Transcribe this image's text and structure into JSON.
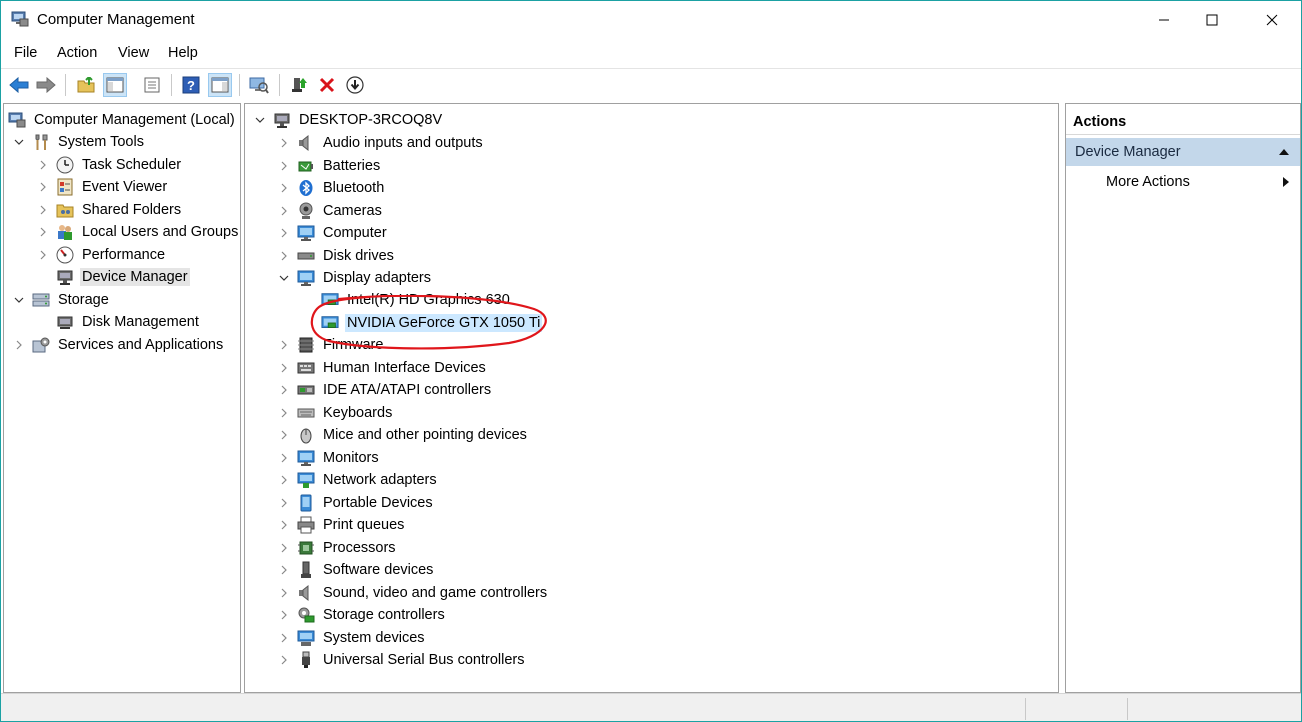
{
  "window": {
    "title": "Computer Management"
  },
  "menu": [
    "File",
    "Action",
    "View",
    "Help"
  ],
  "left_tree": {
    "root": "Computer Management (Local)",
    "system_tools": "System Tools",
    "task_scheduler": "Task Scheduler",
    "event_viewer": "Event Viewer",
    "shared_folders": "Shared Folders",
    "local_users": "Local Users and Groups",
    "performance": "Performance",
    "device_manager": "Device Manager",
    "storage": "Storage",
    "disk_management": "Disk Management",
    "services": "Services and Applications"
  },
  "device_tree": {
    "computer_name": "DESKTOP-3RCOQ8V",
    "categories_before": [
      {
        "label": "Audio inputs and outputs",
        "icon": "speaker-icon"
      },
      {
        "label": "Batteries",
        "icon": "battery-icon"
      },
      {
        "label": "Bluetooth",
        "icon": "bluetooth-icon"
      },
      {
        "label": "Cameras",
        "icon": "camera-icon"
      },
      {
        "label": "Computer",
        "icon": "monitor-icon"
      },
      {
        "label": "Disk drives",
        "icon": "disk-drive-icon"
      }
    ],
    "display_adapters": "Display adapters",
    "display_children": [
      "Intel(R) HD Graphics 630",
      "NVIDIA GeForce GTX 1050 Ti"
    ],
    "categories_after": [
      {
        "label": "Firmware",
        "icon": "firmware-icon"
      },
      {
        "label": "Human Interface Devices",
        "icon": "hid-icon"
      },
      {
        "label": "IDE ATA/ATAPI controllers",
        "icon": "ide-controller-icon"
      },
      {
        "label": "Keyboards",
        "icon": "keyboard-icon"
      },
      {
        "label": "Mice and other pointing devices",
        "icon": "mouse-icon"
      },
      {
        "label": "Monitors",
        "icon": "monitor-icon"
      },
      {
        "label": "Network adapters",
        "icon": "network-adapter-icon"
      },
      {
        "label": "Portable Devices",
        "icon": "portable-device-icon"
      },
      {
        "label": "Print queues",
        "icon": "printer-icon"
      },
      {
        "label": "Processors",
        "icon": "processor-icon"
      },
      {
        "label": "Software devices",
        "icon": "software-device-icon"
      },
      {
        "label": "Sound, video and game controllers",
        "icon": "sound-controller-icon"
      },
      {
        "label": "Storage controllers",
        "icon": "storage-controller-icon"
      },
      {
        "label": "System devices",
        "icon": "system-device-icon"
      },
      {
        "label": "Universal Serial Bus controllers",
        "icon": "usb-icon"
      }
    ]
  },
  "actions": {
    "header": "Actions",
    "section": "Device Manager",
    "more_actions": "More Actions"
  },
  "colors": {
    "accent_border": "#1ba1a3",
    "selection": "#cce8ff",
    "actions_section": "#c3d7ea",
    "annotation_red": "#e0161b"
  }
}
